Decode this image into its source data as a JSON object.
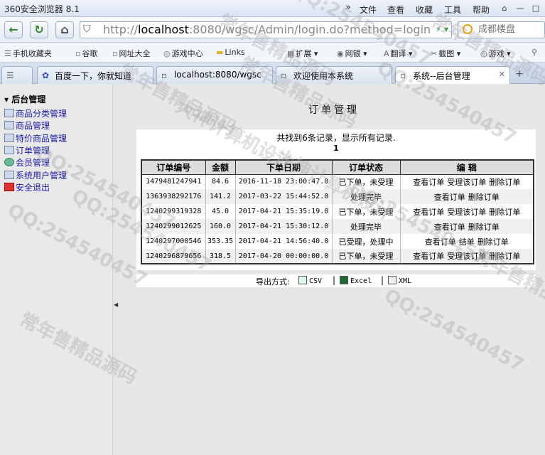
{
  "window": {
    "title": "360安全浏览器 8.1",
    "menu": [
      "文件",
      "查看",
      "收藏",
      "工具",
      "帮助"
    ]
  },
  "addressbar": {
    "url_scheme": "http://",
    "url_host": "localhost",
    "url_rest": ":8080/wgsc/Admin/login.do?method=login",
    "search_placeholder": "成都楼盘"
  },
  "bookmarks": [
    "手机收藏夹",
    "谷歌",
    "网址大全",
    "游戏中心",
    "Links",
    "扩展",
    "网银",
    "翻译",
    "截图",
    "游戏"
  ],
  "tabs": [
    {
      "label": "百度一下，你就知道"
    },
    {
      "label": "localhost:8080/wgsc"
    },
    {
      "label": "欢迎使用本系统"
    },
    {
      "label": "系统--后台管理"
    }
  ],
  "sidebar": {
    "root": "后台管理",
    "items": [
      {
        "label": "商品分类管理"
      },
      {
        "label": "商品管理"
      },
      {
        "label": "特价商品管理"
      },
      {
        "label": "订单管理"
      },
      {
        "label": "会员管理"
      },
      {
        "label": "系统用户管理"
      },
      {
        "label": "安全退出"
      }
    ]
  },
  "main": {
    "title": "订单管理",
    "records_text": "共找到6条记录，显示所有记录.",
    "page": "1",
    "columns": [
      "订单编号",
      "金额",
      "下单日期",
      "订单状态",
      "编 辑"
    ],
    "rows": [
      {
        "id": "1479481247941",
        "amount": "84.6",
        "date": "2016-11-18 23:00:47.0",
        "status": "已下单，未受理",
        "actions": [
          "查看订单",
          "受理该订单",
          "删除订单"
        ]
      },
      {
        "id": "1363938292176",
        "amount": "141.2",
        "date": "2017-03-22 15:44:52.0",
        "status": "处理完毕",
        "actions": [
          "查看订单",
          "删除订单"
        ]
      },
      {
        "id": "1240299319328",
        "amount": "45.0",
        "date": "2017-04-21 15:35:19.0",
        "status": "已下单，未受理",
        "actions": [
          "查看订单",
          "受理该订单",
          "删除订单"
        ]
      },
      {
        "id": "1240299012625",
        "amount": "160.0",
        "date": "2017-04-21 15:30:12.0",
        "status": "处理完毕",
        "actions": [
          "查看订单",
          "删除订单"
        ]
      },
      {
        "id": "1240297000546",
        "amount": "353.35",
        "date": "2017-04-21 14:56:40.0",
        "status": "已受理，处理中",
        "actions": [
          "查看订单",
          "结单",
          "删除订单"
        ]
      },
      {
        "id": "1240296879656",
        "amount": "318.5",
        "date": "2017-04-20 00:00:00.0",
        "status": "已下单，未受理",
        "actions": [
          "查看订单",
          "受理该订单",
          "删除订单"
        ]
      }
    ],
    "export_label": "导出方式:",
    "export_options": [
      "CSV",
      "Excel",
      "XML"
    ]
  },
  "watermarks": [
    "QQ:254540457",
    "常年售精品源码",
    "大神计算机设计"
  ]
}
